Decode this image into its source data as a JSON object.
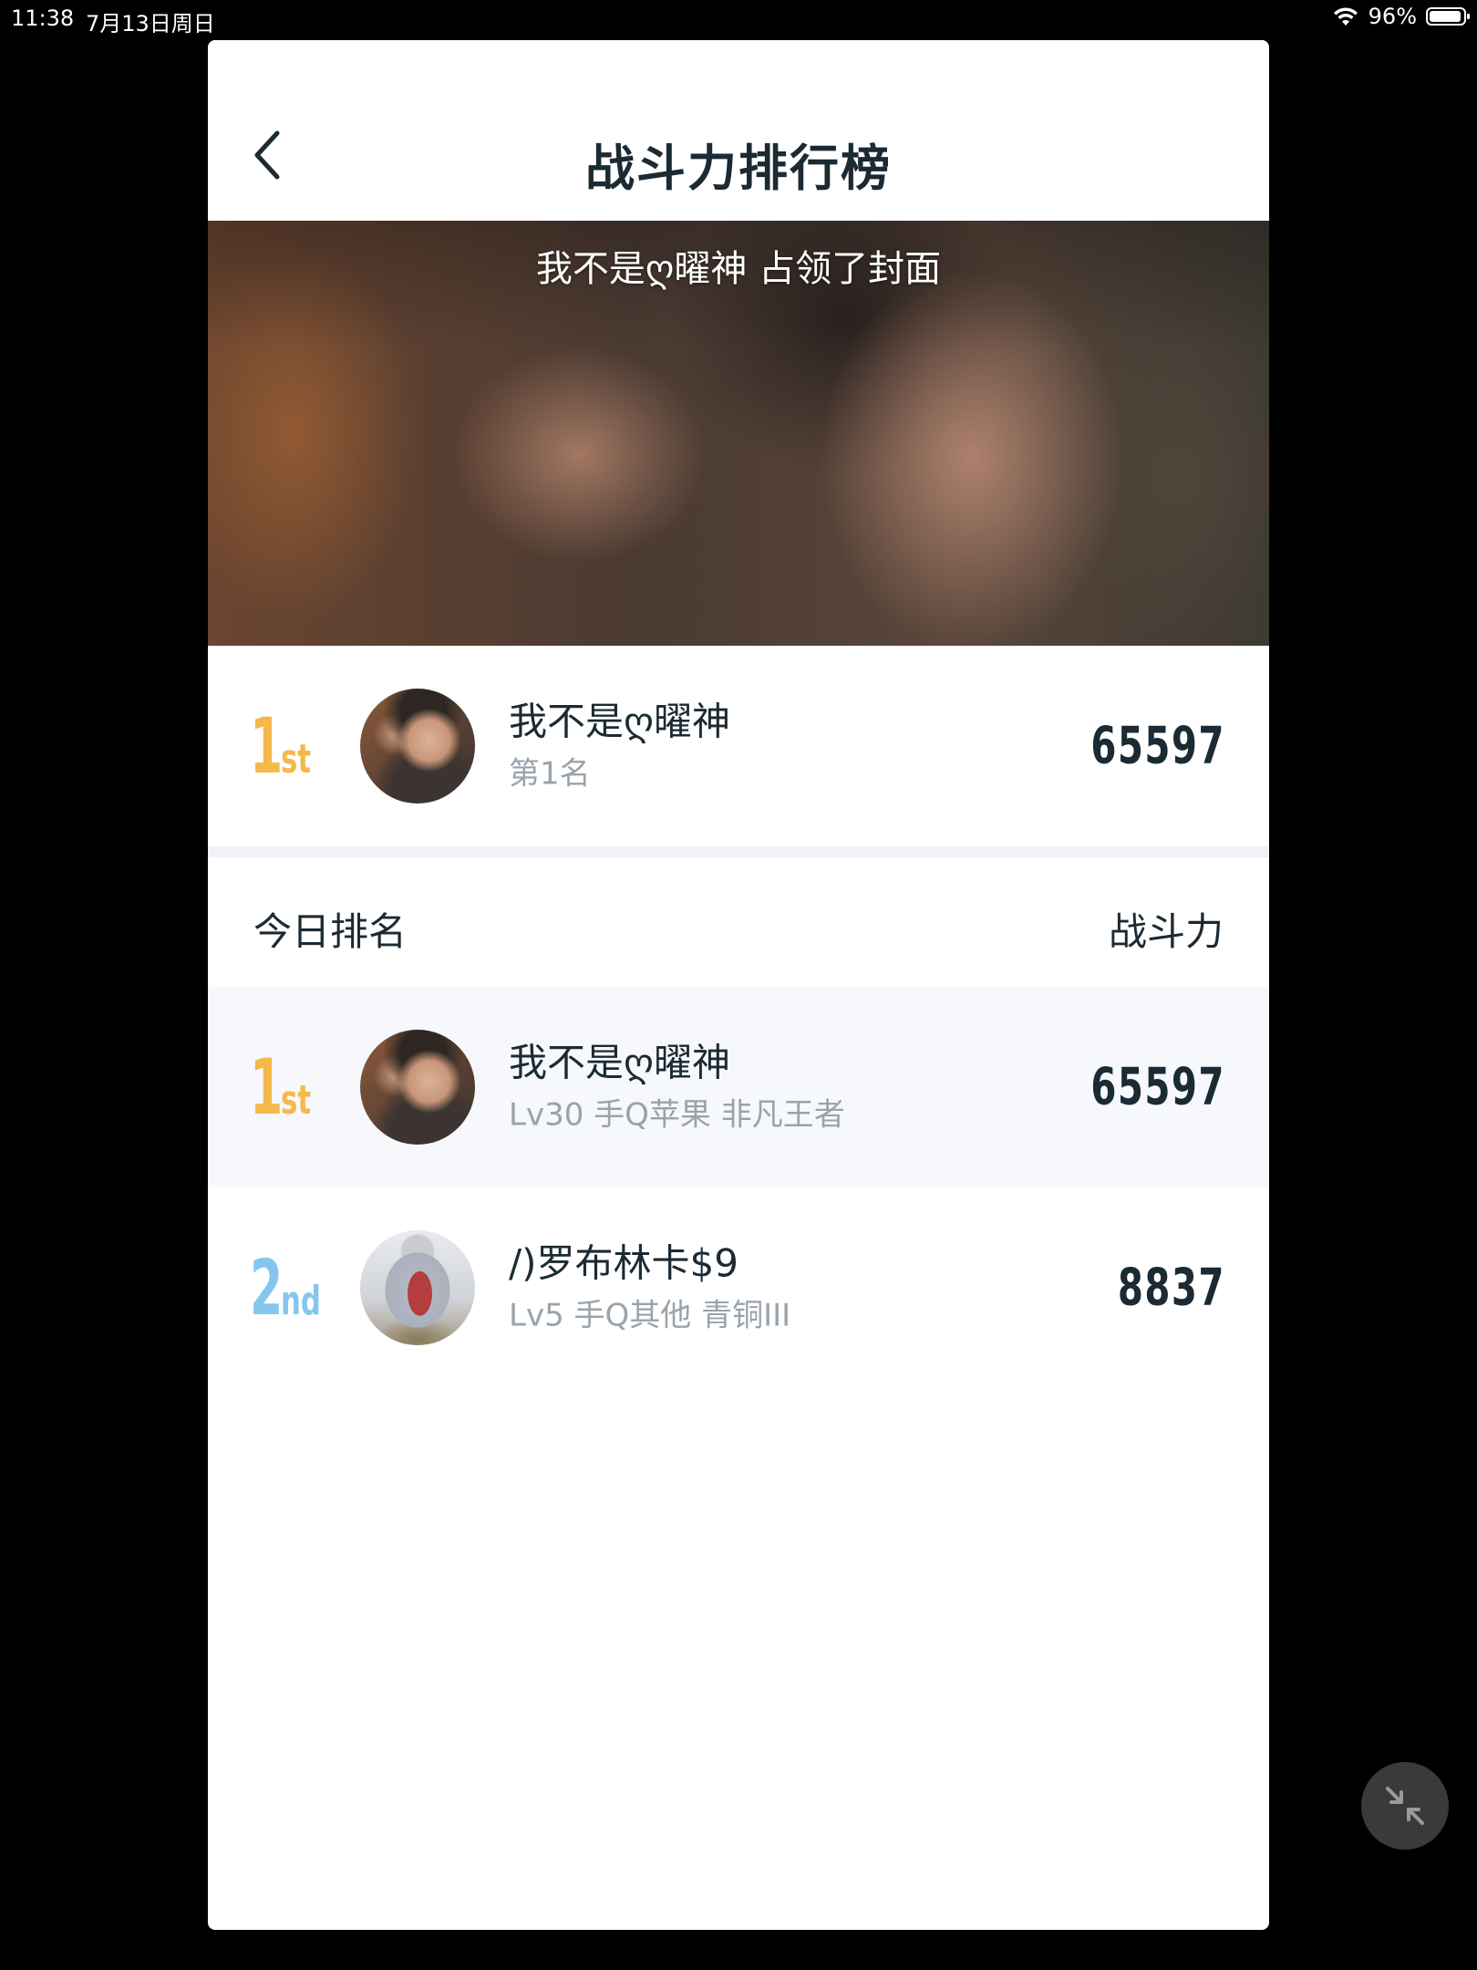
{
  "status_bar": {
    "time": "11:38",
    "date": "7月13日周日",
    "battery": "96%"
  },
  "nav": {
    "title": "战斗力排行榜",
    "back_icon": "chevron-left-icon"
  },
  "cover": {
    "caption": "我不是ღ曜神 占领了封面"
  },
  "top_user": {
    "rank_number": "1",
    "rank_suffix": "st",
    "name": "我不是ღ曜神",
    "subtitle": "第1名",
    "score": "65597"
  },
  "section": {
    "left_label": "今日排名",
    "right_label": "战斗力"
  },
  "ranking": [
    {
      "rank_number": "1",
      "rank_suffix": "st",
      "name": "我不是ღ曜神",
      "subtitle": "Lv30 手Q苹果 非凡王者",
      "score": "65597"
    },
    {
      "rank_number": "2",
      "rank_suffix": "nd",
      "name": "/)罗布林卡$9",
      "subtitle": "Lv5 手Q其他 青铜III",
      "score": "8837"
    }
  ],
  "colors": {
    "gold": "#f5b84a",
    "silver_blue": "#86c6ee",
    "title_text": "#1b2a33",
    "sub_text": "#9aa3ab"
  },
  "floating_button": {
    "icon": "collapse-arrows-icon"
  }
}
